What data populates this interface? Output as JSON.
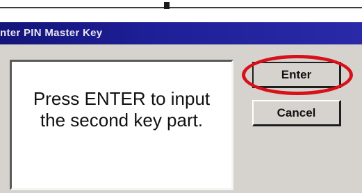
{
  "dialog": {
    "title": "nter PIN Master Key",
    "message_line1": "Press ENTER to input",
    "message_line2": "the second key part."
  },
  "buttons": {
    "enter_label": "Enter",
    "cancel_label": "Cancel"
  },
  "annotation": {
    "highlight_color": "#d8101a",
    "highlight_target": "enter-button"
  },
  "colors": {
    "titlebar": "#1e1e96",
    "dialog_face": "#d6d3ce",
    "message_bg": "#ffffff"
  }
}
